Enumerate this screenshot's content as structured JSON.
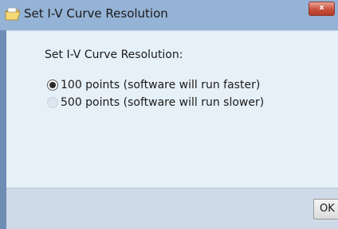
{
  "window": {
    "title": "Set I-V Curve Resolution",
    "close_label": "x"
  },
  "dialog": {
    "prompt": "Set I-V Curve Resolution:",
    "options": [
      {
        "label": "100 points (software will run faster)",
        "selected": true
      },
      {
        "label": "500 points (software will run slower)",
        "selected": false
      }
    ]
  },
  "footer": {
    "ok_label": "OK"
  },
  "colors": {
    "titlebar": "#95b3d6",
    "frame": "#6e8eb5",
    "client_background": "#e6f0f8",
    "footer_background": "#cfdae8",
    "close_button": "#c9503e"
  },
  "icons": {
    "title_icon": "folder-icon",
    "close_icon": "close-icon",
    "selected_radio": "radio-selected-icon",
    "unselected_radio": "radio-unselected-icon"
  }
}
